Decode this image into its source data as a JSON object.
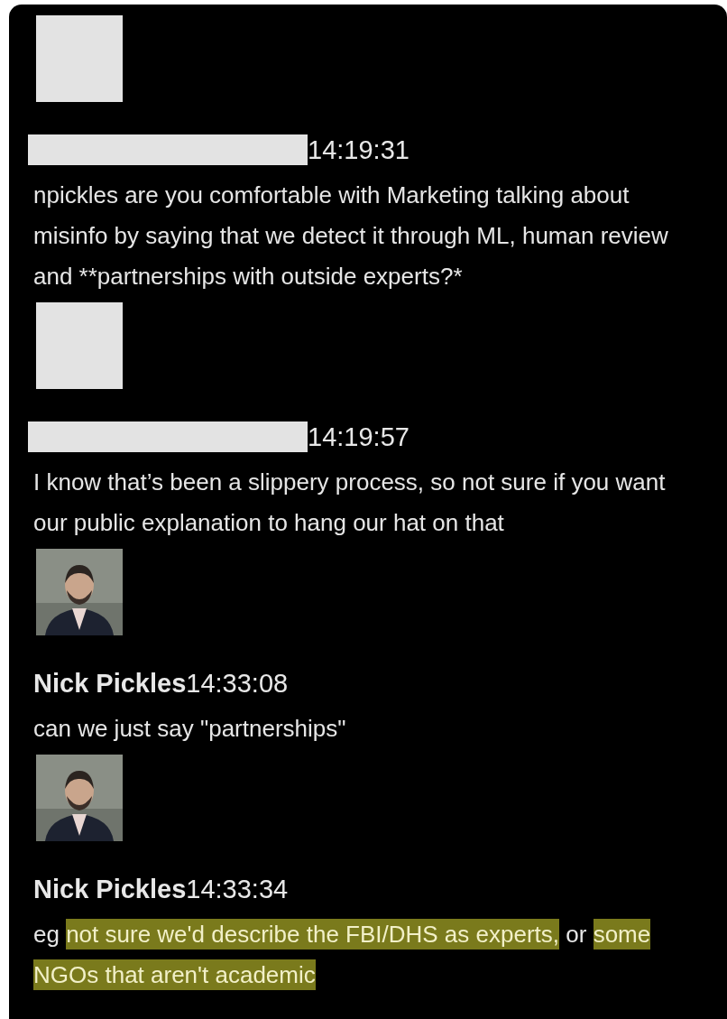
{
  "messages": [
    {
      "avatar": {
        "kind": "redacted"
      },
      "author": {
        "kind": "redacted"
      },
      "time": "14:19:31",
      "text": [
        {
          "text": "npickles are you comfortable with Marketing talking about misinfo by saying that we detect it through ML, human review and **partnerships with outside experts?*",
          "highlighted": false
        }
      ]
    },
    {
      "avatar": {
        "kind": "redacted"
      },
      "author": {
        "kind": "redacted"
      },
      "time": "14:19:57",
      "text": [
        {
          "text": "I know that’s been a slippery process, so not sure if you want our public explanation to hang our hat on that",
          "highlighted": false
        }
      ]
    },
    {
      "author": {
        "kind": "named",
        "name": "Nick Pickles"
      },
      "time": "14:33:08",
      "text": [
        {
          "text": "can we just say \"partnerships\"",
          "highlighted": false
        }
      ]
    },
    {
      "author": {
        "kind": "named",
        "name": "Nick Pickles"
      },
      "time": "14:33:34",
      "text": [
        {
          "text": "eg ",
          "highlighted": false
        },
        {
          "text": "not sure we'd describe the FBI/DHS as experts,",
          "highlighted": true
        },
        {
          "text": " or ",
          "highlighted": false
        },
        {
          "text": "some NGOs that aren't academic",
          "highlighted": true
        }
      ]
    }
  ]
}
